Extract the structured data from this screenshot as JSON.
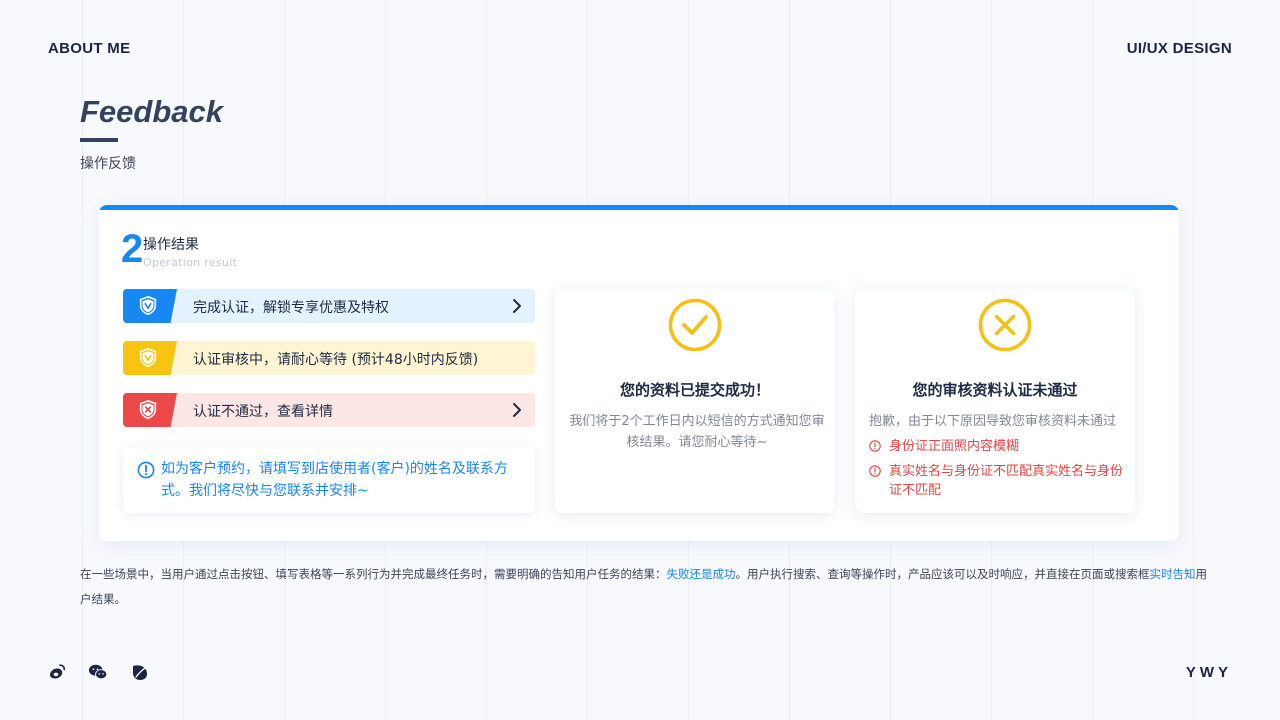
{
  "header": {
    "left": "ABOUT ME",
    "right": "UI/UX DESIGN"
  },
  "section": {
    "title": "Feedback",
    "subtitle": "操作反馈"
  },
  "card": {
    "number": "2",
    "title": "操作结果",
    "subtitle": "Operation result",
    "accent": "#1787f2",
    "bars": [
      {
        "label": "完成认证，解锁专享优惠及特权",
        "color": "#1787f2",
        "bg": "#e4f1ff",
        "icon": "shield-check-icon"
      },
      {
        "label": "认证审核中，请耐心等待 (预计48小时内反馈)",
        "color": "#f7c411",
        "bg": "#fff5d2",
        "icon": "shield-pending-icon"
      },
      {
        "label": "认证不通过，查看详情",
        "color": "#ec4848",
        "bg": "#fde6e6",
        "icon": "shield-x-icon"
      }
    ],
    "notice": "如为客户预约，请填写到店使用者(客户)的姓名及联系方式。我们将尽快与您联系并安排~",
    "success": {
      "title": "您的资料已提交成功！",
      "desc": "我们将于2个工作日内以短信的方式通知您审核结果。请您耐心等待~",
      "icon": "check-circle-icon"
    },
    "fail": {
      "title": "您的审核资料认证未通过",
      "desc": "抱歉，由于以下原因导致您审核资料未通过",
      "reasons": [
        "身份证正面照内容模糊",
        "真实姓名与身份证不匹配真实姓名与身份证不匹配"
      ],
      "icon": "x-circle-icon"
    }
  },
  "footer": {
    "p1": "在一些场景中，当用户通过点击按钮、填写表格等一系列行为并完成最终任务时，需要明确的告知用户任务的结果：",
    "hl1": "失败还是成功",
    "p2": "。用户执行搜索、查询等操作时，产品应该可以及时响应，并直接在页面或搜索框",
    "hl2": "实时告知",
    "p3": "用户结果。"
  },
  "social": [
    "weibo-icon",
    "wechat-icon",
    "leaf-icon"
  ],
  "brand": "YWY"
}
